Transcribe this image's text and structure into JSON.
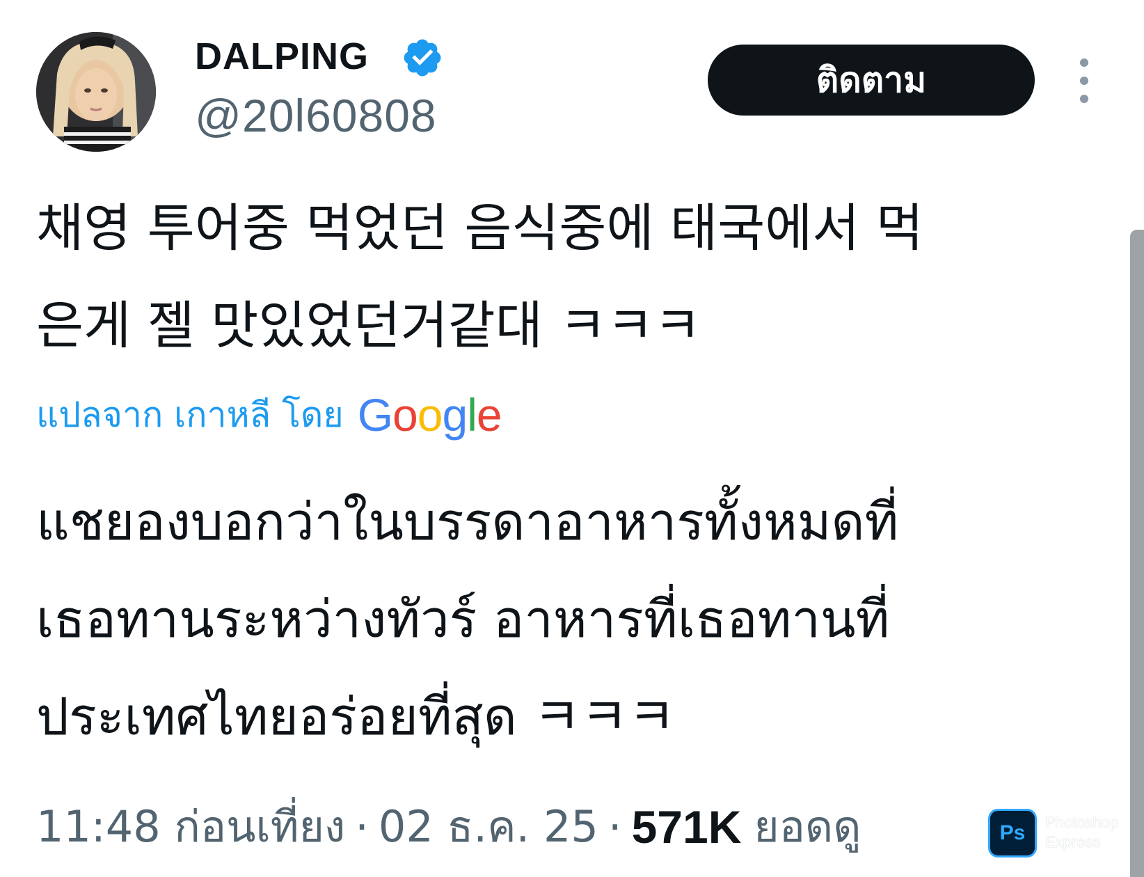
{
  "tweet": {
    "author": {
      "display_name": "DALPING",
      "handle": "@20l60808",
      "verified": true,
      "avatar_icon": "profile-photo"
    },
    "follow_label": "ติดตาม",
    "more_icon": "vertical-dots-icon",
    "text_lines": [
      "채영 투어중 먹었던 음식중에 태국에서 먹",
      "은게 젤 맛있었던거같대 ㅋㅋㅋ"
    ],
    "translation": {
      "label": "แปลจาก เกาหลี โดย",
      "provider": "Google"
    },
    "translated_lines": [
      "แชยองบอกว่าในบรรดาอาหารทั้งหมดที่",
      "เธอทานระหว่างทัวร์ อาหารที่เธอทานที่",
      "ประเทศไทยอร่อยที่สุด ㅋㅋㅋ"
    ],
    "meta": {
      "time": "11:48 ก่อนเที่ยง",
      "separator": "·",
      "date": "02 ธ.ค. 25",
      "views_count": "571K",
      "views_label": "ยอดดู"
    }
  },
  "watermark": {
    "badge": "Ps",
    "line1": "Photoshop",
    "line2": "Express"
  },
  "colors": {
    "text_primary": "#0f1419",
    "text_secondary": "#536471",
    "accent": "#1d9bf0",
    "verified": "#1d9bf0",
    "button_bg": "#0f1419"
  }
}
